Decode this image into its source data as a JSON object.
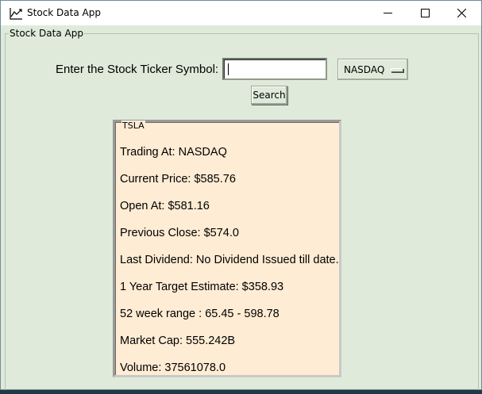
{
  "window": {
    "title": "Stock Data App"
  },
  "frame": {
    "label": "Stock Data App"
  },
  "search": {
    "prompt": "Enter the Stock Ticker Symbol:",
    "value": "",
    "button_label": "Search"
  },
  "exchange": {
    "selected": "NASDAQ"
  },
  "result": {
    "ticker": "TSLA",
    "rows": [
      "Trading At: NASDAQ",
      "Current Price: $585.76",
      "Open At: $581.16",
      "Previous Close: $574.0",
      "Last Dividend: No Dividend Issued till date.",
      "1 Year Target Estimate: $358.93",
      "52 week range : 65.45 - 598.78",
      "Market Cap: 555.242B",
      "Volume: 37561078.0"
    ]
  },
  "colors": {
    "background": "#dfeadb",
    "result_panel": "#ffecd4"
  },
  "icons": {
    "app": "chart-line-icon",
    "minimize": "minimize-icon",
    "maximize": "maximize-icon",
    "close": "close-icon"
  }
}
